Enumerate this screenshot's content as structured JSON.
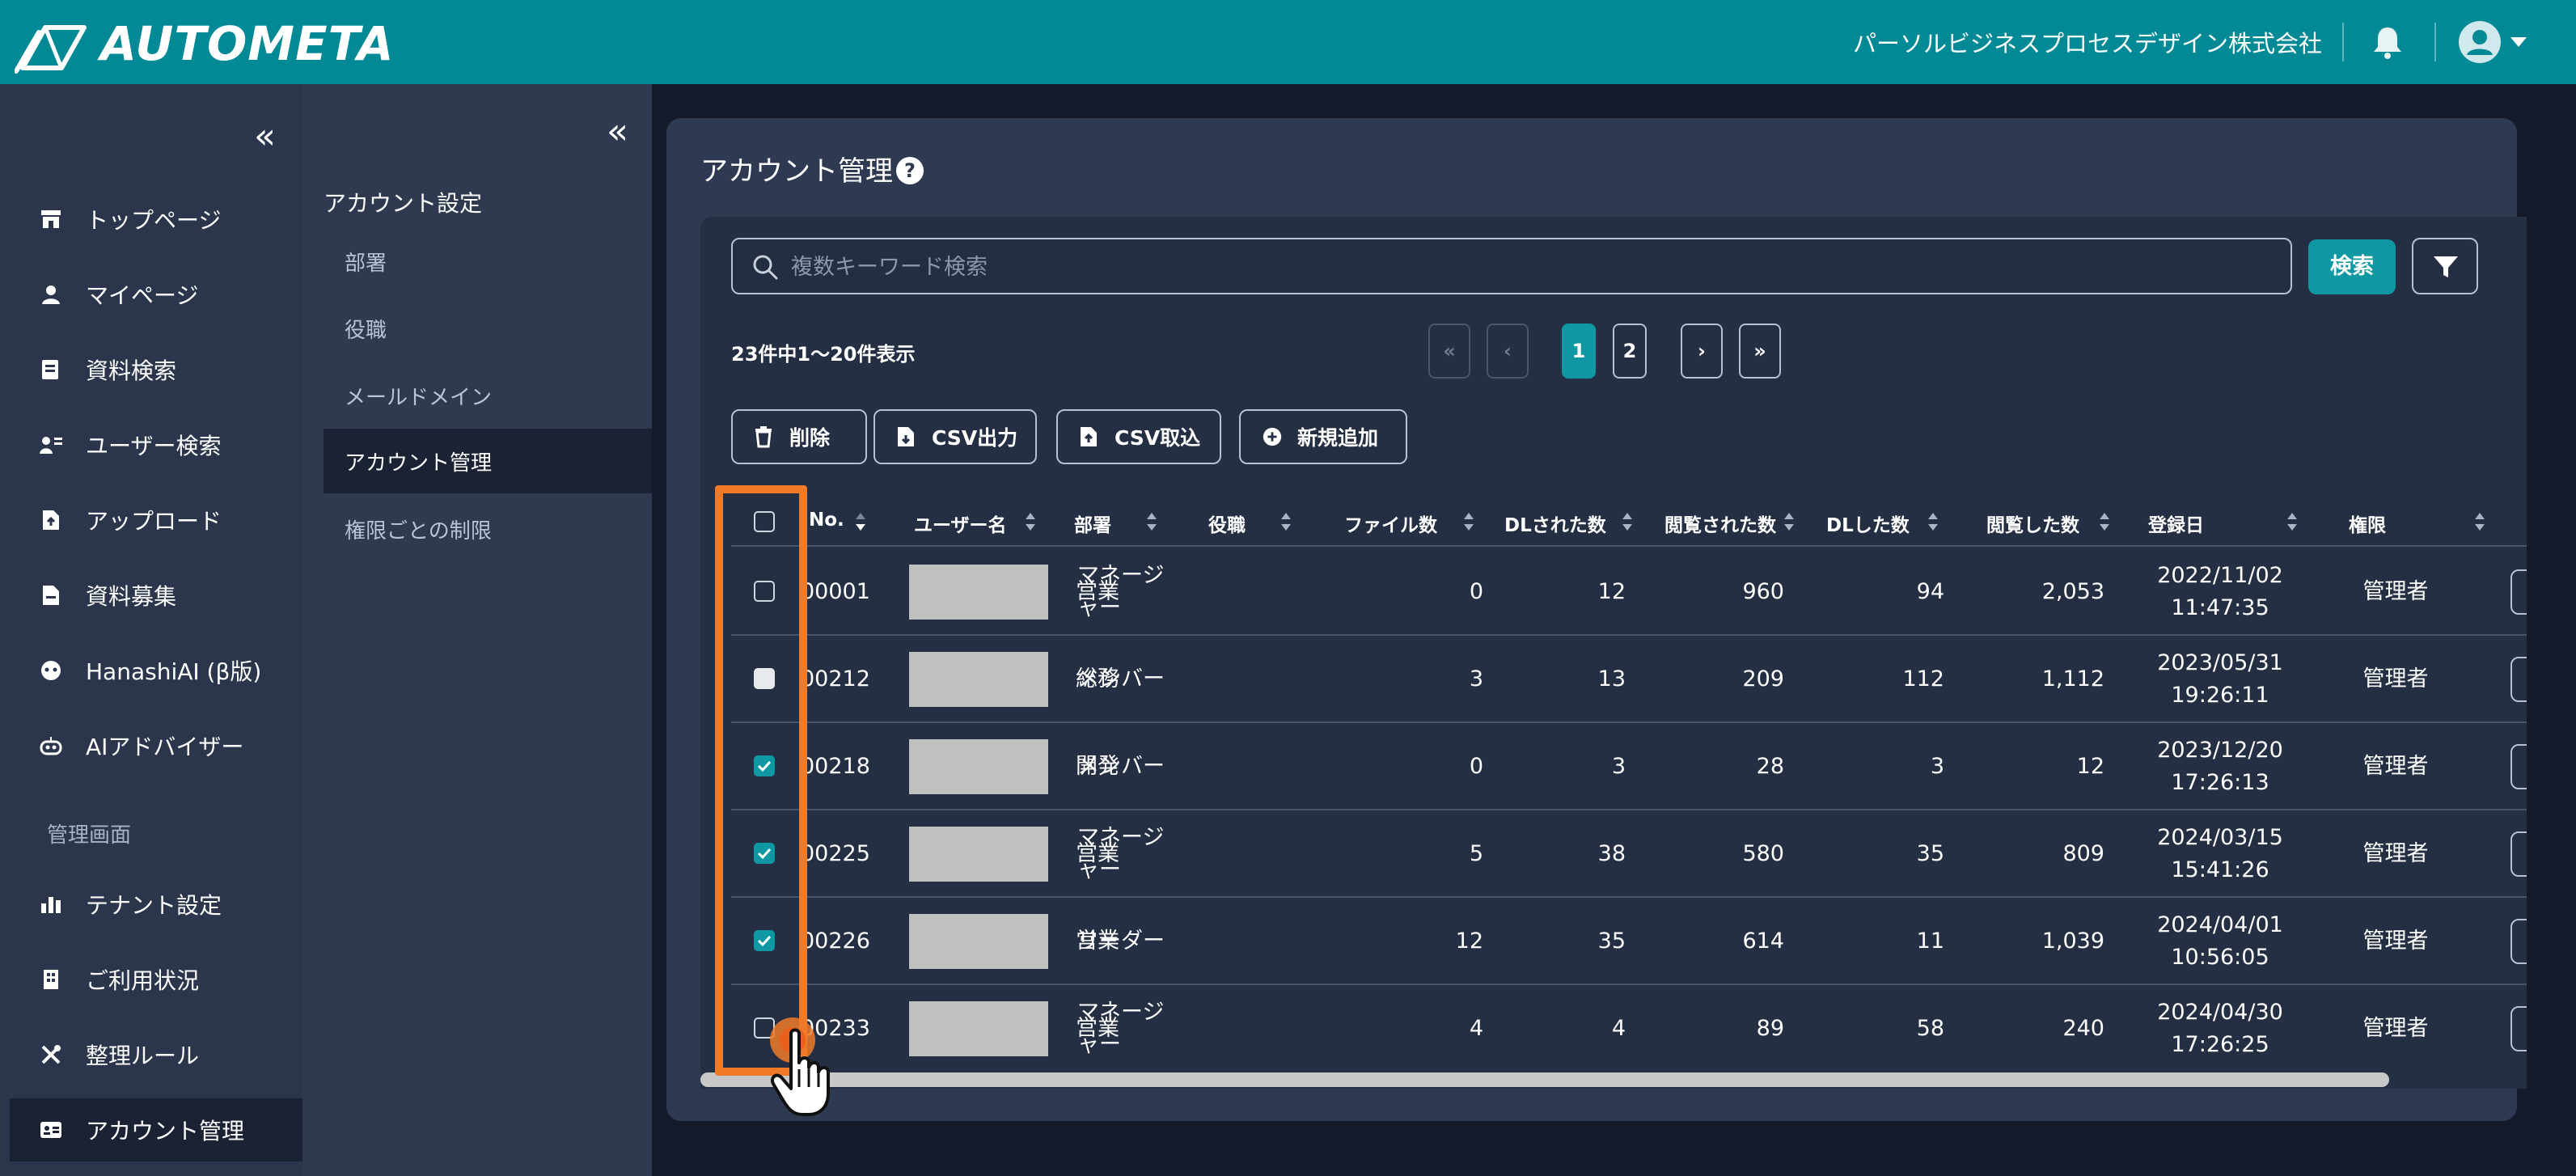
{
  "header": {
    "logo_text": "AUTOMETA",
    "company": "パーソルビジネスプロセスデザイン株式会社",
    "icons": [
      "bell-icon",
      "user-avatar-icon",
      "caret-down-icon"
    ],
    "accent_color": "#018a95"
  },
  "sidebar": {
    "collapse": "«",
    "items": [
      {
        "label": "トップページ",
        "icon": "store-icon"
      },
      {
        "label": "マイページ",
        "icon": "person-icon"
      },
      {
        "label": "資料検索",
        "icon": "documents-icon"
      },
      {
        "label": "ユーザー検索",
        "icon": "user-search-icon"
      },
      {
        "label": "アップロード",
        "icon": "upload-file-icon"
      },
      {
        "label": "資料募集",
        "icon": "file-icon"
      },
      {
        "label": "HanashiAI (β版)",
        "icon": "chat-bot-icon"
      },
      {
        "label": "AIアドバイザー",
        "icon": "robot-icon"
      }
    ],
    "section_label": "管理画面",
    "admin_items": [
      {
        "label": "テナント設定",
        "icon": "building-chart-icon"
      },
      {
        "label": "ご利用状況",
        "icon": "building-icon"
      },
      {
        "label": "整理ルール",
        "icon": "tools-icon"
      },
      {
        "label": "アカウント管理",
        "icon": "id-card-icon"
      }
    ]
  },
  "subnav": {
    "collapse": "«",
    "title": "アカウント設定",
    "items": [
      {
        "label": "部署"
      },
      {
        "label": "役職"
      },
      {
        "label": "メールドメイン"
      },
      {
        "label": "アカウント管理"
      },
      {
        "label": "権限ごとの制限"
      }
    ]
  },
  "main": {
    "title": "アカウント管理",
    "help": "?",
    "search": {
      "placeholder": "複数キーワード検索",
      "value": "",
      "button": "検索"
    },
    "result_count": "23件中1〜20件表示",
    "pagination": {
      "first": "«",
      "prev": "‹",
      "pages": [
        "1",
        "2"
      ],
      "current": "1",
      "next": "›",
      "last": "»"
    },
    "actions": [
      {
        "label": "削除",
        "icon": "trash-icon"
      },
      {
        "label": "CSV出力",
        "icon": "file-download-icon"
      },
      {
        "label": "CSV取込",
        "icon": "file-upload-icon"
      },
      {
        "label": "新規追加",
        "icon": "plus-circle-icon"
      }
    ],
    "table": {
      "headers": [
        "No.",
        "ユーザー名",
        "部署",
        "役職",
        "ファイル数",
        "DLされた数",
        "閲覧された数",
        "DLした数",
        "閲覧した数",
        "登録日",
        "権限"
      ],
      "rows": [
        {
          "no": "00001",
          "dept": "営業",
          "role": [
            "マネージ",
            "ャー"
          ],
          "files": "0",
          "dled": "12",
          "viewed": "960",
          "dl": "94",
          "view": "2,053",
          "date": "2022/11/02",
          "time": "11:47:35",
          "auth": "管理者",
          "check": "unchecked"
        },
        {
          "no": "00212",
          "dept": "総務",
          "role": [
            "メンバー"
          ],
          "files": "3",
          "dled": "13",
          "viewed": "209",
          "dl": "112",
          "view": "1,112",
          "date": "2023/05/31",
          "time": "19:26:11",
          "auth": "管理者",
          "check": "half"
        },
        {
          "no": "00218",
          "dept": "開発",
          "role": [
            "メンバー"
          ],
          "files": "0",
          "dled": "3",
          "viewed": "28",
          "dl": "3",
          "view": "12",
          "date": "2023/12/20",
          "time": "17:26:13",
          "auth": "管理者",
          "check": "checked"
        },
        {
          "no": "00225",
          "dept": "営業",
          "role": [
            "マネージ",
            "ャー"
          ],
          "files": "5",
          "dled": "38",
          "viewed": "580",
          "dl": "35",
          "view": "809",
          "date": "2024/03/15",
          "time": "15:41:26",
          "auth": "管理者",
          "check": "checked"
        },
        {
          "no": "00226",
          "dept": "営業",
          "role": [
            "リーダー"
          ],
          "files": "12",
          "dled": "35",
          "viewed": "614",
          "dl": "11",
          "view": "1,039",
          "date": "2024/04/01",
          "time": "10:56:05",
          "auth": "管理者",
          "check": "checked"
        },
        {
          "no": "00233",
          "dept": "営業",
          "role": [
            "マネージ",
            "ャー"
          ],
          "files": "4",
          "dled": "4",
          "viewed": "89",
          "dl": "58",
          "view": "240",
          "date": "2024/04/30",
          "time": "17:26:25",
          "auth": "管理者",
          "check": "unchecked"
        }
      ]
    }
  }
}
